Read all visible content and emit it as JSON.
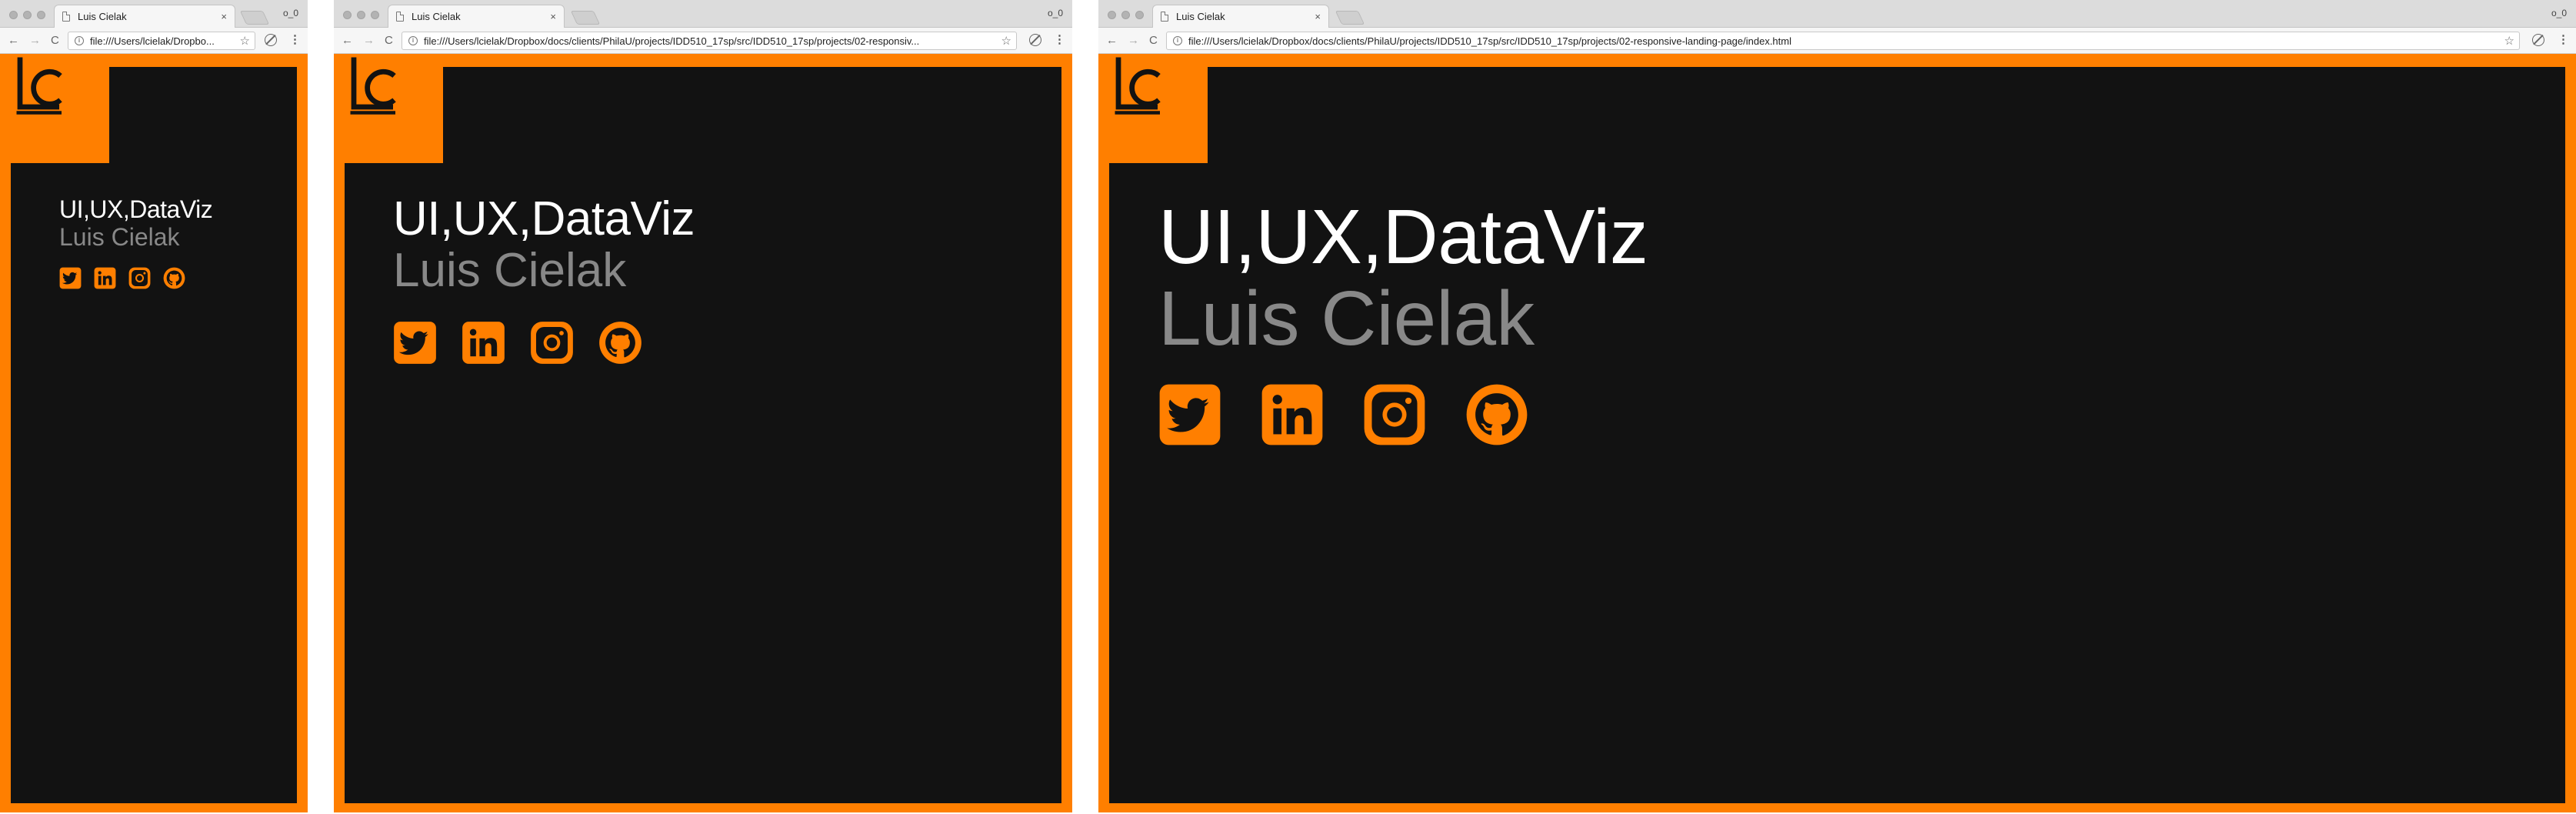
{
  "browser": {
    "tab_title": "Luis Cielak",
    "tab_close": "×",
    "profile": "o_0",
    "url_truncated_small": "file:///Users/lcielak/Dropbo...",
    "url_truncated_medium": "file:///Users/lcielak/Dropbox/docs/clients/PhilaU/projects/IDD510_17sp/src/IDD510_17sp/projects/02-responsiv...",
    "url_full": "file:///Users/lcielak/Dropbox/docs/clients/PhilaU/projects/IDD510_17sp/src/IDD510_17sp/projects/02-responsive-landing-page/index.html",
    "back": "←",
    "forward": "→",
    "reload": "C",
    "star": "☆",
    "menu": "⋮"
  },
  "page": {
    "logo_text": "lc",
    "headline": "UI,UX,DataViz",
    "name": "Luis Cielak",
    "socials": [
      {
        "icon": "twitter-icon",
        "label": "Twitter"
      },
      {
        "icon": "linkedin-icon",
        "label": "LinkedIn"
      },
      {
        "icon": "instagram-icon",
        "label": "Instagram"
      },
      {
        "icon": "github-icon",
        "label": "GitHub"
      }
    ]
  },
  "colors": {
    "accent": "#ff7f00",
    "background": "#121212",
    "headline": "#ffffff",
    "name": "#888888"
  }
}
